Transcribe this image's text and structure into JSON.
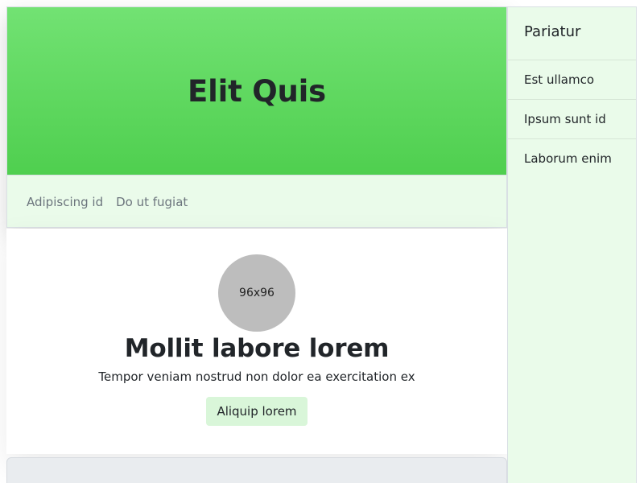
{
  "header": {
    "title": "Elit Quis",
    "nav": [
      "Adipiscing id",
      "Do ut fugiat"
    ]
  },
  "profile": {
    "avatar_label": "96x96",
    "title": "Mollit labore lorem",
    "subtitle": "Tempor veniam nostrud non dolor ea exercitation ex",
    "button_label": "Aliquip lorem"
  },
  "sidebar": {
    "title": "Pariatur",
    "items": [
      "Est ullamco",
      "Ipsum sunt id",
      "Laborum enim"
    ]
  },
  "colors": {
    "hero_top": "#72e273",
    "hero_bottom": "#4fcf4f",
    "pale_green": "#eafbea",
    "button_bg": "#d9f6d9",
    "avatar_gray": "#bdbdbd"
  }
}
